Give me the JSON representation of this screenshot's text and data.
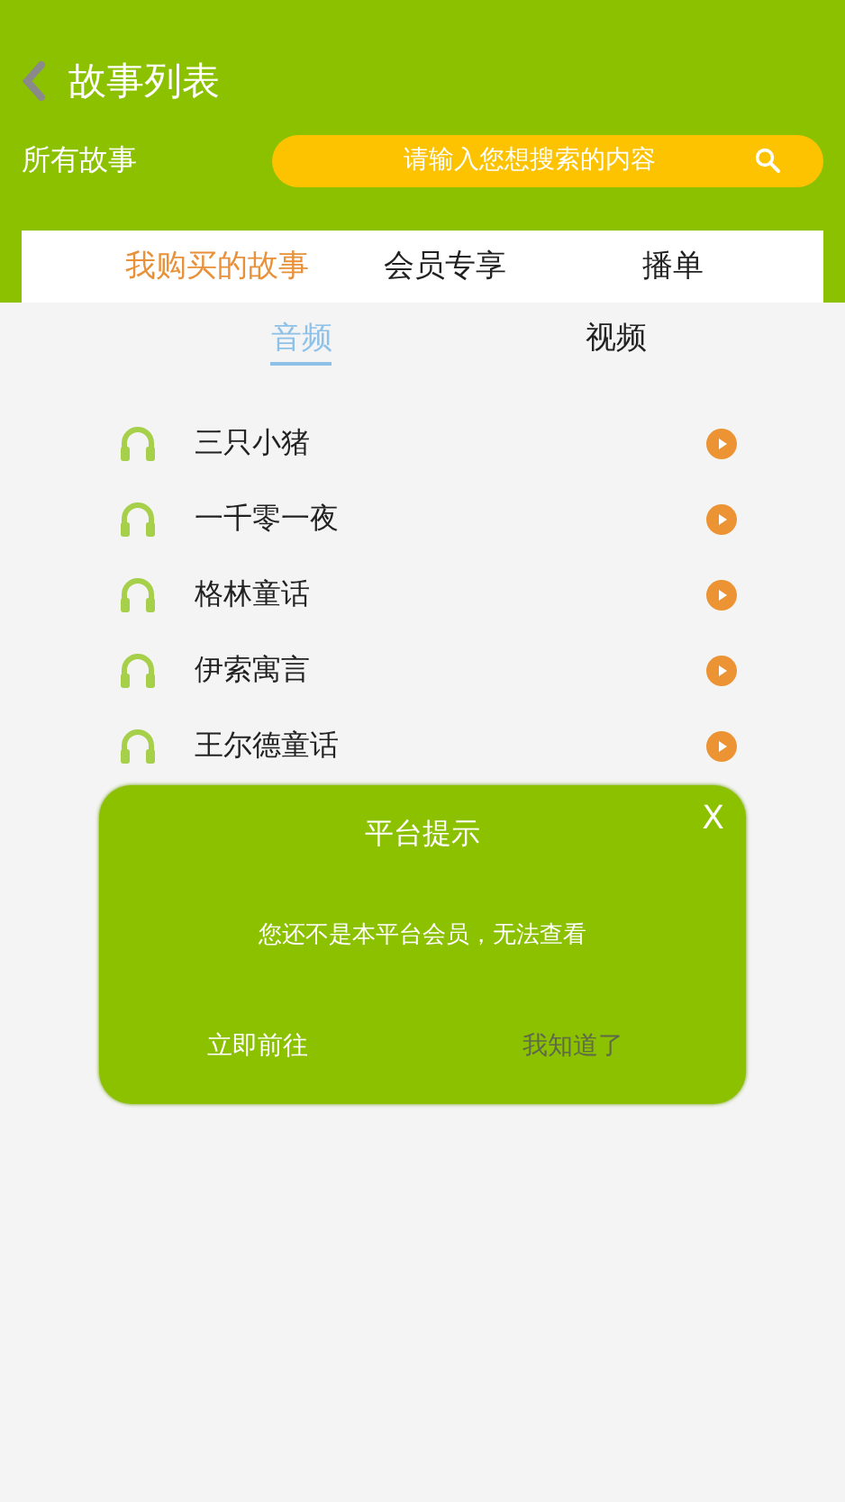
{
  "header": {
    "title": "故事列表",
    "section_label": "所有故事",
    "search": {
      "placeholder": "请输入您想搜索的内容"
    }
  },
  "tabs": [
    {
      "label": "我购买的故事",
      "selected": true
    },
    {
      "label": "会员专享",
      "selected": false
    },
    {
      "label": "播单",
      "selected": false
    }
  ],
  "subtabs": [
    {
      "label": "音频",
      "selected": true
    },
    {
      "label": "视频",
      "selected": false
    }
  ],
  "stories": [
    {
      "title": "三只小猪"
    },
    {
      "title": "一千零一夜"
    },
    {
      "title": "格林童话"
    },
    {
      "title": "伊索寓言"
    },
    {
      "title": "王尔德童话"
    }
  ],
  "dialog": {
    "title": "平台提示",
    "close": "X",
    "message": "您还不是本平台会员，无法查看",
    "buttons": [
      {
        "label": "立即前往",
        "disabled": false
      },
      {
        "label": "我知道了",
        "disabled": true
      }
    ]
  }
}
